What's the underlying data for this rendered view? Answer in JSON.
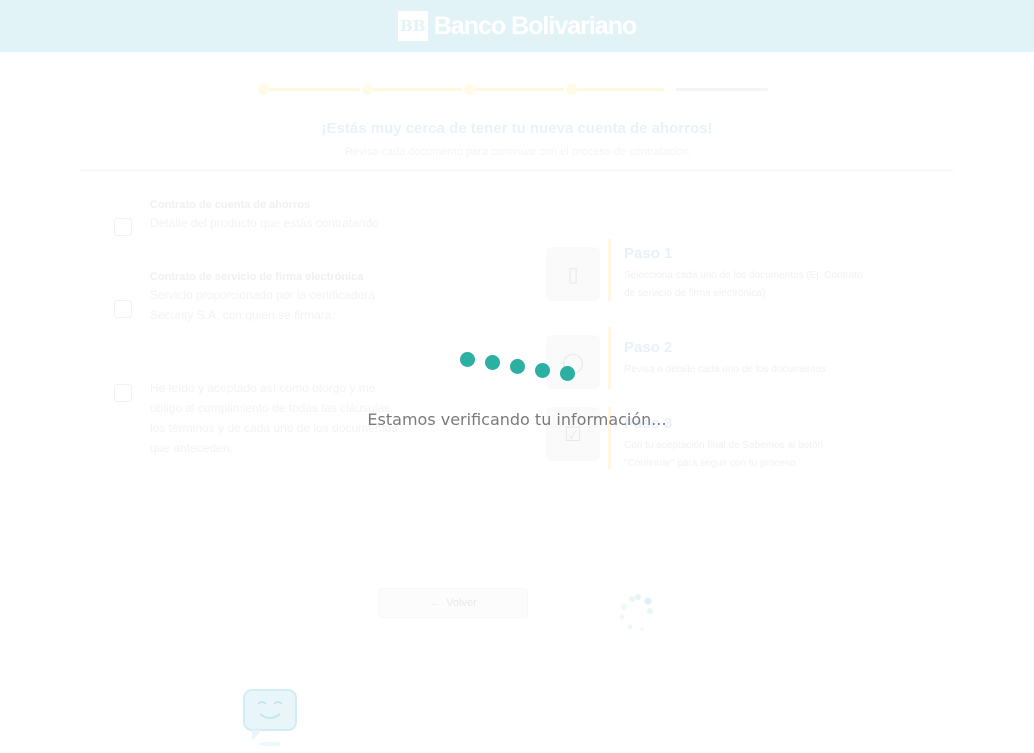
{
  "header": {
    "brand_name": "Banco Bolivariano",
    "logo_icon": "bank-logo-icon",
    "background_color": "#e2f3f7"
  },
  "background": {
    "title": "¡Estás muy cerca de tener tu nueva cuenta de ahorros!",
    "subtitle": "Revisa cada documento para continuar con el proceso de contratación",
    "documents": [
      {
        "title": "Contrato de cuenta de ahorros",
        "description": "Detalle del producto que estás contratando"
      },
      {
        "title": "Contrato de servicio de firma electrónica",
        "description": "Servicio proporcionado por la certificadora Security S.A. con quien se firmará."
      },
      {
        "title": "",
        "description": "He leído y aceptado así como otorgo y me obligo al cumplimiento de todas las cláusulas, los términos y de cada uno de los documentos que anteceden."
      }
    ],
    "steps": [
      {
        "name": "Paso 1",
        "description": "Selecciona cada uno de los documentos (Ej: Contrato de servicio de firma electrónica)",
        "icon": "document-icon"
      },
      {
        "name": "Paso 2",
        "description": "Revisa a detalle cada uno de los documentos",
        "icon": "search-icon"
      },
      {
        "name": "Paso 3",
        "description": "Con tu aceptación final de Sabemos al botón \"Continuar\" para seguir con tu proceso",
        "icon": "check-square-icon"
      }
    ],
    "back_button": "Volver",
    "back_icon": "arrow-left-icon",
    "assistant_icon": "chat-bot-icon"
  },
  "loader": {
    "message": "Estamos verificando tu información...",
    "dot_color": "#2bb0a3",
    "dot_count": 5
  }
}
